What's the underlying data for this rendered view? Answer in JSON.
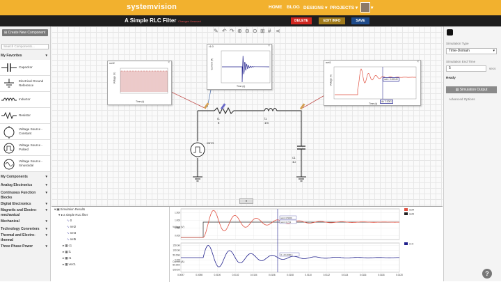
{
  "app": {
    "logo": "systemvision"
  },
  "nav": {
    "home": "HOME",
    "blog": "BLOG",
    "designs": "DESIGNS",
    "projects": "PROJECTS"
  },
  "design": {
    "title": "A Simple RLC Filter",
    "status": "Changes Unsaved",
    "delete_label": "DELETE",
    "edit_label": "EDIT INFO",
    "save_label": "SAVE"
  },
  "left": {
    "create_label": "Create New Component",
    "search_placeholder": "Search Components...",
    "favorites_label": "My Favorites",
    "components": [
      {
        "label": "Capacitor",
        "icon": "capacitor-icon"
      },
      {
        "label": "Electrical Ground Reference",
        "icon": "ground-icon"
      },
      {
        "label": "Inductor",
        "icon": "inductor-icon"
      },
      {
        "label": "Resistor",
        "icon": "resistor-icon"
      },
      {
        "label": "Voltage Source - Constant",
        "icon": "voltage-source-constant-icon"
      },
      {
        "label": "Voltage Source - Pulsed",
        "icon": "voltage-source-pulsed-icon"
      },
      {
        "label": "Voltage Source - Sinusoidal",
        "icon": "voltage-source-sinusoidal-icon"
      }
    ],
    "categories": [
      "My Components",
      "Analog Electronics",
      "Continuous Function Blocks",
      "Digital Electronics",
      "Magnetic and Electro-mechanical",
      "Mechanical",
      "Technology Converters",
      "Thermal and Electro-thermal",
      "Three Phase Power"
    ]
  },
  "right": {
    "sim_type_label": "Simulation Type",
    "sim_type_value": "Time-Domain",
    "end_time_label": "Simulation End Time",
    "end_time_value": "5",
    "end_time_unit": "secs",
    "status": "Ready",
    "sim_output_label": "Simulation Output",
    "advanced_label": "Advanced Options"
  },
  "schematic": {
    "r1_name": "r1",
    "r1_value": "5",
    "l1_name": "l1",
    "l1_value": "1m",
    "c1_name": "c1",
    "c1_value": "1u",
    "src_name": "vsrc1"
  },
  "probes": {
    "net2": {
      "title": "net2",
      "ylabel": "Voltage (V)",
      "xlabel": "Time (s)"
    },
    "r1": {
      "title": "r1:0",
      "ylabel": "Current (A)",
      "xlabel": "Time (s)"
    },
    "net1": {
      "title": "net1",
      "ylabel": "Voltage (V)",
      "xlabel": "Time (s)",
      "cursor_a": "net1: 0.00043",
      "cursor_b": "dx: 2.0001"
    }
  },
  "results": {
    "root": "Simulation Results",
    "design": "a simple RLC filter",
    "nets": [
      "0",
      "net2",
      "net4",
      "net5",
      "c1",
      "l1",
      "r1",
      "vsrc1"
    ],
    "voltage_legend": [
      "net4",
      "net3"
    ],
    "current_legend": [
      "r1:0"
    ],
    "voltage_ylabel": "Voltage (V)",
    "current_ylabel": "Current (A)",
    "cursor_readouts": [
      "net4: 0.5000",
      "net4: 0.743"
    ],
    "current_readouts": [
      "r1: 23.2000m"
    ],
    "time_ticks": [
      "0.0097",
      "0.0098",
      "0.0100",
      "0.0102",
      "0.0104",
      "0.0106",
      "0.0108",
      "0.0110",
      "0.0112",
      "0.0114",
      "0.0116",
      "0.0118",
      "0.0120"
    ],
    "volt_ticks": [
      "1.500",
      "1.000",
      "0.500",
      "0.000"
    ],
    "curr_ticks": [
      "150.0m",
      "100.0m",
      "50.00m",
      "0.000",
      "-50.00m",
      "-100.0m"
    ]
  },
  "colors": {
    "brand": "#f2b12e",
    "net4_trace": "#e05040",
    "net3_trace": "#222222",
    "current_trace": "#20208c",
    "cursor": "#3a3a9a"
  }
}
